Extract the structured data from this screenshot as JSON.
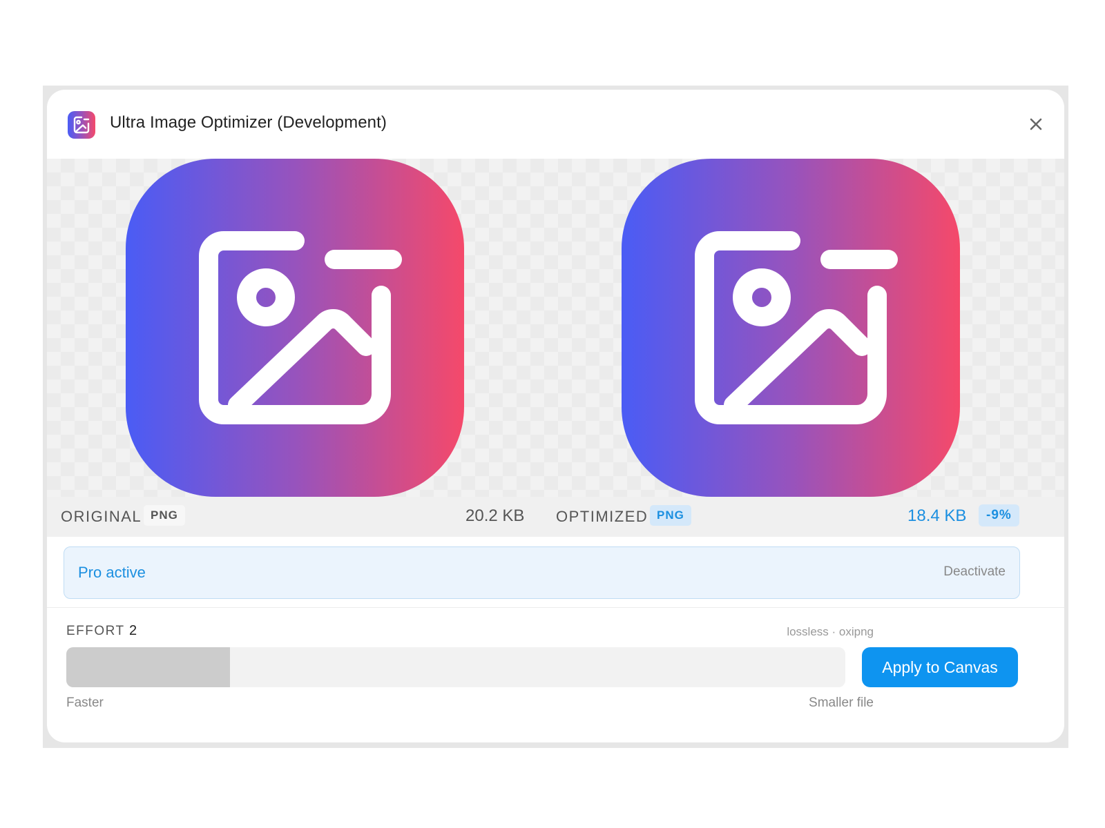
{
  "app": {
    "title": "Ultra Image Optimizer (Development)",
    "icon": "image-edit-icon"
  },
  "colors": {
    "gradient_start": "#4a5cf5",
    "gradient_mid": "#9753bd",
    "gradient_end": "#f5496a",
    "accent": "#0e94f0",
    "accent_text": "#1b8fe0"
  },
  "original": {
    "label": "ORIGINAL",
    "format": "PNG",
    "size": "20.2 KB"
  },
  "optimized": {
    "label": "OPTIMIZED",
    "format": "PNG",
    "size": "18.4 KB",
    "change": "-9%"
  },
  "pro": {
    "status": "Pro active",
    "action": "Deactivate"
  },
  "effort": {
    "label": "EFFORT",
    "value": "2",
    "method": "lossless · oxipng",
    "level_fraction": 0.21,
    "min_label": "Faster",
    "max_label": "Smaller file"
  },
  "actions": {
    "apply": "Apply to Canvas"
  }
}
